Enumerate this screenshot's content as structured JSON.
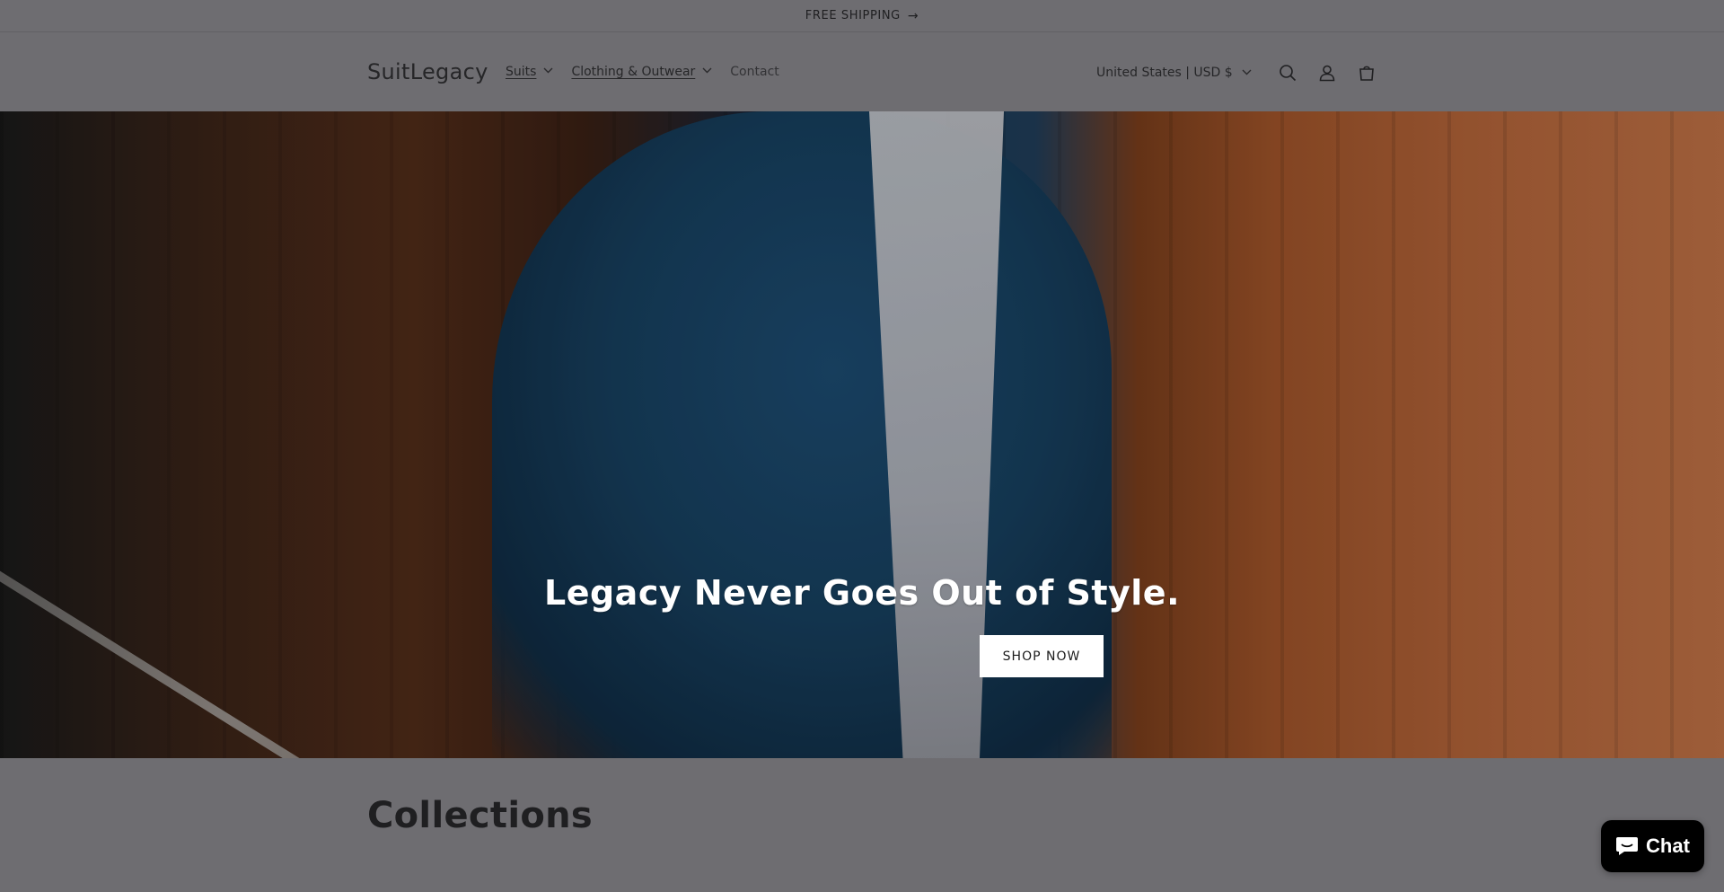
{
  "announcement": {
    "text": "FREE SHIPPING",
    "arrow": "→"
  },
  "header": {
    "logo": "SuitLegacy",
    "nav": [
      {
        "label": "Suits",
        "has_dropdown": true
      },
      {
        "label": "Clothing & Outwear",
        "has_dropdown": true
      },
      {
        "label": "Contact",
        "has_dropdown": false
      }
    ],
    "country_selector": "United States | USD $",
    "icons": [
      "search-icon",
      "account-icon",
      "cart-icon"
    ]
  },
  "hero": {
    "heading": "Legacy Never Goes Out of Style.",
    "button_label": "SHOP NOW"
  },
  "collections": {
    "title": "Collections"
  },
  "chat": {
    "label": "Chat"
  },
  "colors": {
    "page_background": "#6e6d71",
    "hero_button_bg": "#ffffff",
    "chat_bg": "#000000"
  }
}
